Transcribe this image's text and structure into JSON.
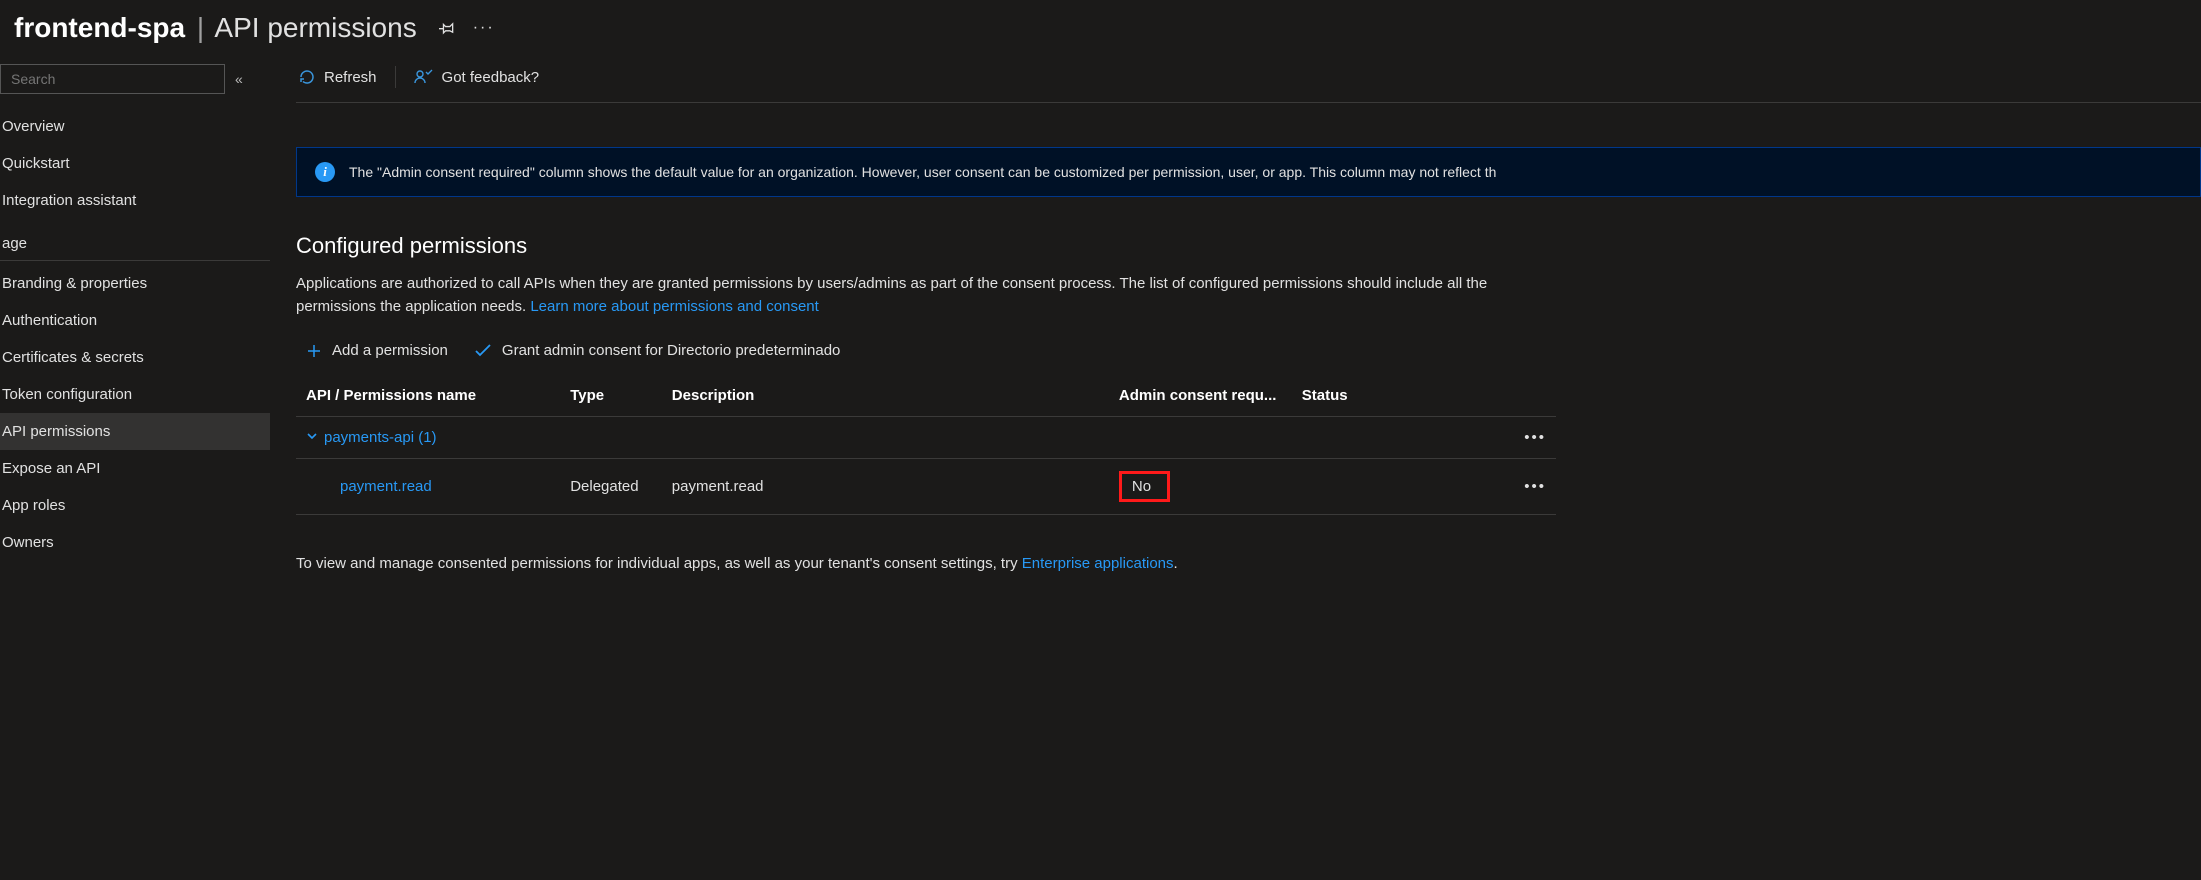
{
  "header": {
    "app_name": "frontend-spa",
    "page_name": "API permissions"
  },
  "sidebar": {
    "search_placeholder": "Search",
    "items_top": [
      "Overview",
      "Quickstart",
      "Integration assistant"
    ],
    "section_label": "age",
    "items_manage": [
      "Branding & properties",
      "Authentication",
      "Certificates & secrets",
      "Token configuration",
      "API permissions",
      "Expose an API",
      "App roles",
      "Owners"
    ],
    "selected": "API permissions"
  },
  "toolbar": {
    "refresh": "Refresh",
    "feedback": "Got feedback?"
  },
  "info_banner": "The \"Admin consent required\" column shows the default value for an organization. However, user consent can be customized per permission, user, or app. This column may not reflect th",
  "section": {
    "title": "Configured permissions",
    "desc": "Applications are authorized to call APIs when they are granted permissions by users/admins as part of the consent process. The list of configured permissions should include all the permissions the application needs. ",
    "learn_more": "Learn more about permissions and consent"
  },
  "actions": {
    "add": "Add a permission",
    "grant": "Grant admin consent for Directorio predeterminado"
  },
  "table": {
    "headers": {
      "name": "API / Permissions name",
      "type": "Type",
      "desc": "Description",
      "admin": "Admin consent requ...",
      "status": "Status"
    },
    "group": {
      "name": "payments-api (1)"
    },
    "rows": [
      {
        "name": "payment.read",
        "type": "Delegated",
        "desc": "payment.read",
        "admin": "No",
        "status": ""
      }
    ]
  },
  "footer": {
    "text": "To view and manage consented permissions for individual apps, as well as your tenant's consent settings, try ",
    "link": "Enterprise applications",
    "suffix": "."
  }
}
